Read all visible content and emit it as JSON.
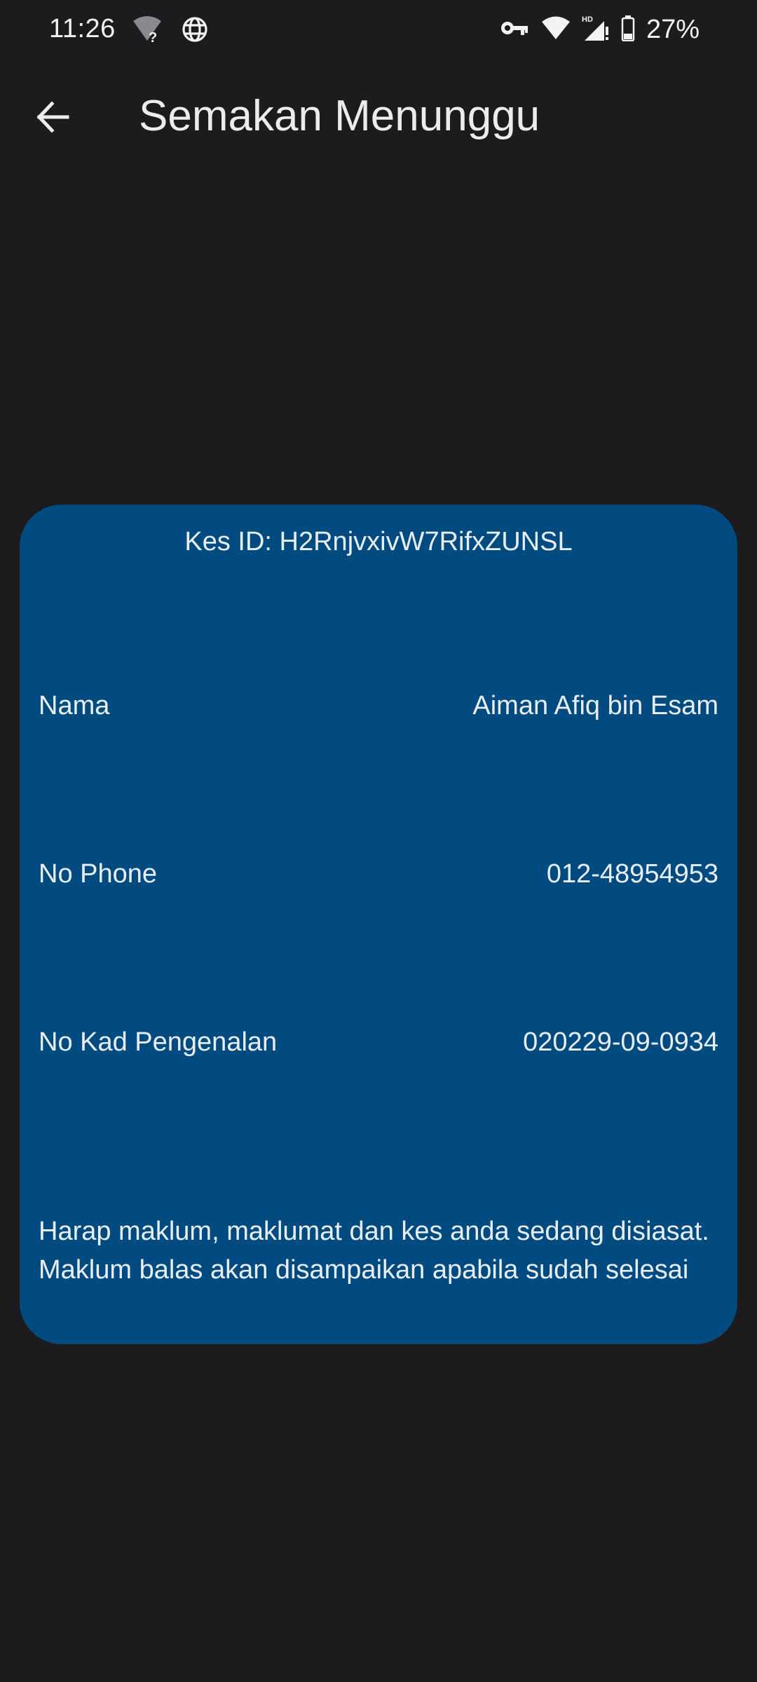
{
  "status_bar": {
    "time": "11:26",
    "battery_percent": "27%",
    "icons": [
      "wifi-unknown-icon",
      "globe-icon",
      "vpn-key-icon",
      "wifi-icon",
      "signal-hd-icon",
      "battery-icon"
    ]
  },
  "app_bar": {
    "title": "Semakan Menunggu",
    "back_icon": "arrow-back-icon"
  },
  "card": {
    "case_id": "Kes ID: H2RnjvxivW7RifxZUNSL",
    "rows": [
      {
        "label": "Nama",
        "value": "Aiman Afiq bin Esam"
      },
      {
        "label": "No Phone",
        "value": "012-48954953"
      },
      {
        "label": "No Kad Pengenalan",
        "value": "020229-09-0934"
      }
    ],
    "notice": "Harap maklum, maklumat dan kes anda sedang disiasat. Maklum balas akan disampaikan apabila sudah selesai",
    "background_color": "#024b80"
  },
  "colors": {
    "background": "#1c1c1e",
    "text": "#e8e8ea"
  }
}
